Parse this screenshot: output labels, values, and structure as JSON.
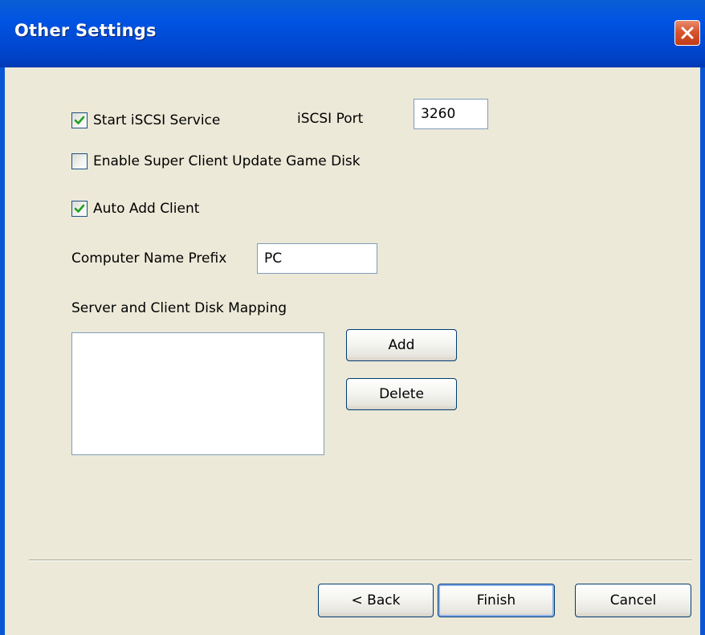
{
  "window": {
    "title": "Other Settings"
  },
  "options": {
    "start_iscsi": {
      "label": "Start iSCSI Service",
      "checked": true
    },
    "iscsi_port": {
      "label": "iSCSI Port",
      "value": "3260"
    },
    "super_client_update": {
      "label": "Enable Super Client Update Game Disk",
      "checked": false
    },
    "auto_add_client": {
      "label": "Auto Add Client",
      "checked": true
    },
    "computer_name_prefix": {
      "label": "Computer Name Prefix",
      "value": "PC"
    },
    "disk_mapping": {
      "label": "Server and Client Disk Mapping",
      "items": []
    }
  },
  "mapping_buttons": {
    "add": "Add",
    "delete": "Delete"
  },
  "footer": {
    "back": "< Back",
    "finish": "Finish",
    "cancel": "Cancel"
  },
  "colors": {
    "titlebar": "#0054e3",
    "dialog_bg": "#ece9d8",
    "checkmark": "#21a121",
    "close_button": "#d8552e"
  }
}
